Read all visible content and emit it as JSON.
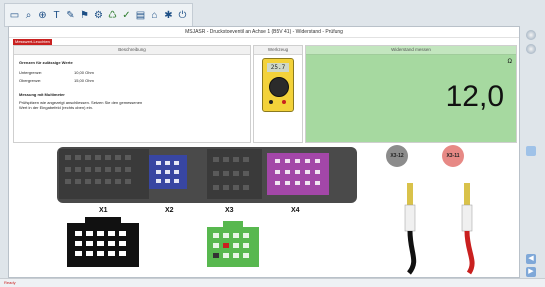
{
  "toolbar": {
    "icons": [
      "monitor-icon",
      "search-icon",
      "zoom-icon",
      "tools-icon",
      "edit-icon",
      "flag-icon",
      "gear-icon",
      "recycle-icon",
      "check-icon",
      "document-icon",
      "home-icon",
      "settings-icon",
      "exit-icon"
    ]
  },
  "window": {
    "title": "MSJASR - Druckstoeventil an Achse 1 (B5V 41) - Widerstand - Prüfung"
  },
  "tag": {
    "label": "Messwert-Leuchten"
  },
  "description": {
    "header": "Beschreibung",
    "limits_heading": "Grenzen für zulässige Werte",
    "lower_label": "Untergrenze:",
    "lower_value": "10,00 Ohm",
    "upper_label": "Obergrenze:",
    "upper_value": "15,00 Ohm",
    "procedure_heading": "Messung mit Multimeter",
    "procedure_text": "Prüfspitzen wie angezeigt anschliessen. Setzen Sie den gemessenen Wert in der Eingabefeld (rechts oben) ein."
  },
  "tool": {
    "header": "Werkzeug",
    "display": "25.7"
  },
  "resistance": {
    "header": "Widerstand messen",
    "unit": "Ω",
    "value": "12,0"
  },
  "connectors": {
    "x1": "X1",
    "x2": "X2",
    "x3": "X3",
    "x4": "X4"
  },
  "probes": {
    "black": "X3-12",
    "red": "X3-11"
  },
  "colors": {
    "accent": "#c9201f",
    "resist_bg": "#a6d9a0",
    "x2": "#3846a2",
    "x4": "#a347a8",
    "x3": "#58b84f"
  },
  "status": {
    "text": "Ready"
  }
}
